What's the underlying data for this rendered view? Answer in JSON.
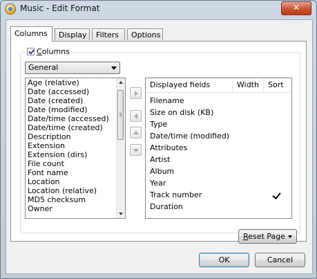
{
  "window": {
    "title": "Music - Edit Format",
    "close_label": "✕"
  },
  "tabs": [
    "Columns",
    "Display",
    "Filters",
    "Options"
  ],
  "columns_group": {
    "checkbox_label_underlined": "C",
    "checkbox_label_rest": "olumns",
    "checked": true
  },
  "category_select": {
    "value": "General"
  },
  "available_fields": [
    "Age (relative)",
    "Date (accessed)",
    "Date (created)",
    "Date (modified)",
    "Date/time (accessed)",
    "Date/time (created)",
    "Description",
    "Extension",
    "Extension (dirs)",
    "File count",
    "Font name",
    "Location",
    "Location (relative)",
    "MD5 checksum",
    "Owner"
  ],
  "displayed_fields": {
    "headers": {
      "name": "Displayed fields",
      "width": "Width",
      "sort": "Sort"
    },
    "rows": [
      "Filename",
      "Size on disk (KB)",
      "Type",
      "Date/time (modified)",
      "Attributes",
      "Artist",
      "Album",
      "Year",
      "Track number",
      "Duration"
    ],
    "sort_checked_row": "Track number"
  },
  "buttons": {
    "reset_underlined": "R",
    "reset_rest": "eset Page",
    "ok": "OK",
    "cancel": "Cancel"
  }
}
